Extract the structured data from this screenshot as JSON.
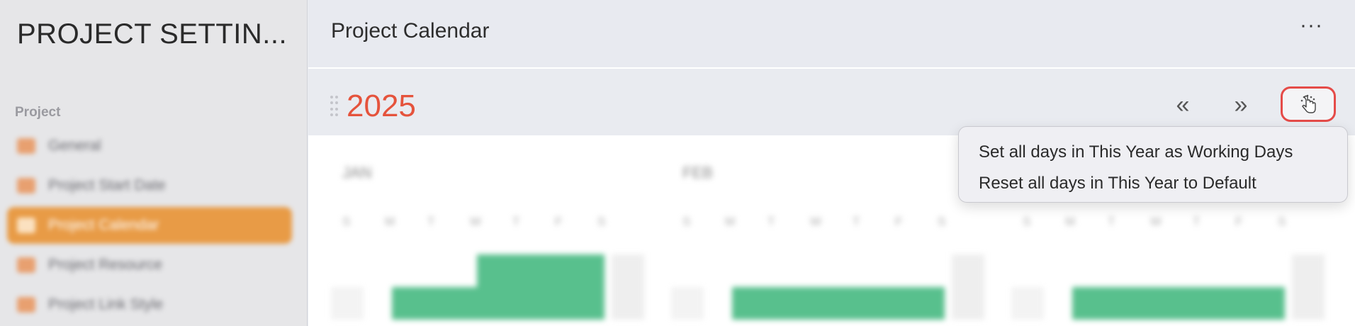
{
  "sidebar": {
    "title": "PROJECT SETTIN...",
    "section_label": "Project",
    "items": [
      {
        "label": "General",
        "active": false
      },
      {
        "label": "Project Start Date",
        "active": false
      },
      {
        "label": "Project Calendar",
        "active": true
      },
      {
        "label": "Project Resource",
        "active": false
      },
      {
        "label": "Project Link Style",
        "active": false
      }
    ]
  },
  "header": {
    "title": "Project Calendar",
    "more_label": "···"
  },
  "toolbar": {
    "year": "2025",
    "prev_label": "«",
    "next_label": "»",
    "days_button_icon": "hand-pointer-icon"
  },
  "calendar": {
    "months": [
      {
        "name": "JAN",
        "weekdays": [
          "S",
          "M",
          "T",
          "W",
          "T",
          "F",
          "S"
        ]
      },
      {
        "name": "FEB",
        "weekdays": [
          "S",
          "M",
          "T",
          "W",
          "T",
          "F",
          "S"
        ]
      },
      {
        "name": "",
        "weekdays": [
          "S",
          "M",
          "T",
          "W",
          "T",
          "F",
          "S"
        ]
      }
    ]
  },
  "popup": {
    "items": [
      "Set all days in This Year as Working Days",
      "Reset all days in This Year to Default"
    ]
  },
  "colors": {
    "accent_year": "#e5533c",
    "active_sidebar": "#e89b46",
    "working_day": "#58c08d",
    "focus_ring": "#e54b48"
  }
}
